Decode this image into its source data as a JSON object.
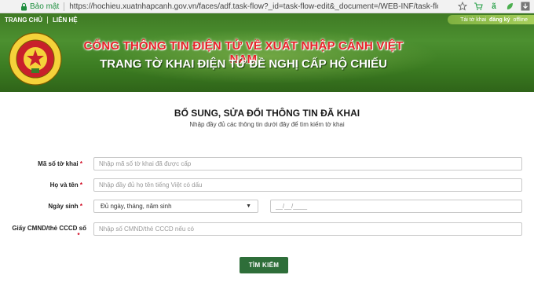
{
  "browser": {
    "secure_label": "Bảo mật",
    "url": "https://hochieu.xuatnhapcanh.gov.vn/faces/adf.task-flow?_id=task-flow-edit&_document=/WEB-INF/task-flo"
  },
  "header": {
    "nav": [
      "TRANG CHỦ",
      "LIÊN HỆ"
    ],
    "account_prefix": "Tải tờ khai",
    "account_bold": "đăng ký",
    "account_suffix": "offline",
    "title_line1": "CỔNG THÔNG TIN ĐIỆN TỬ VỀ XUẤT NHẬP CẢNH VIỆT NAM",
    "title_line2": "TRANG TỜ KHAI ĐIỆN TỬ ĐỀ NGHỊ CẤP HỘ CHIẾU",
    "emblem_text": "QUẢN LÝ XUẤT NHẬP CẢNH · IMMIGRATION"
  },
  "form": {
    "title": "BỔ SUNG, SỬA ĐỔI THÔNG TIN ĐÃ KHAI",
    "subtitle": "Nhập đầy đủ các thông tin dưới đây để tìm kiếm tờ khai",
    "fields": {
      "declaration_no": {
        "label": "Mã số tờ khai",
        "placeholder": "Nhập mã số tờ khai đã được cấp",
        "value": ""
      },
      "full_name": {
        "label": "Họ và tên",
        "placeholder": "Nhập đầy đủ họ tên tiếng Việt có dấu",
        "value": ""
      },
      "birth_date": {
        "label": "Ngày sinh",
        "select_value": "Đủ ngày, tháng, năm sinh",
        "date_placeholder": "__/__/____"
      },
      "id_card": {
        "label_line1": "Giấy CMND/thẻ CCCD số",
        "placeholder": "Nhập số CMND/thẻ CCCD nếu có",
        "value": ""
      }
    },
    "required_mark": "*",
    "search_button": "TÌM KIẾM"
  },
  "colors": {
    "header_green": "#3f7a24",
    "title_red": "#e8232a",
    "button_green": "#2e6e39",
    "required_red": "#d0021b",
    "secure_green": "#1e8e3e"
  }
}
